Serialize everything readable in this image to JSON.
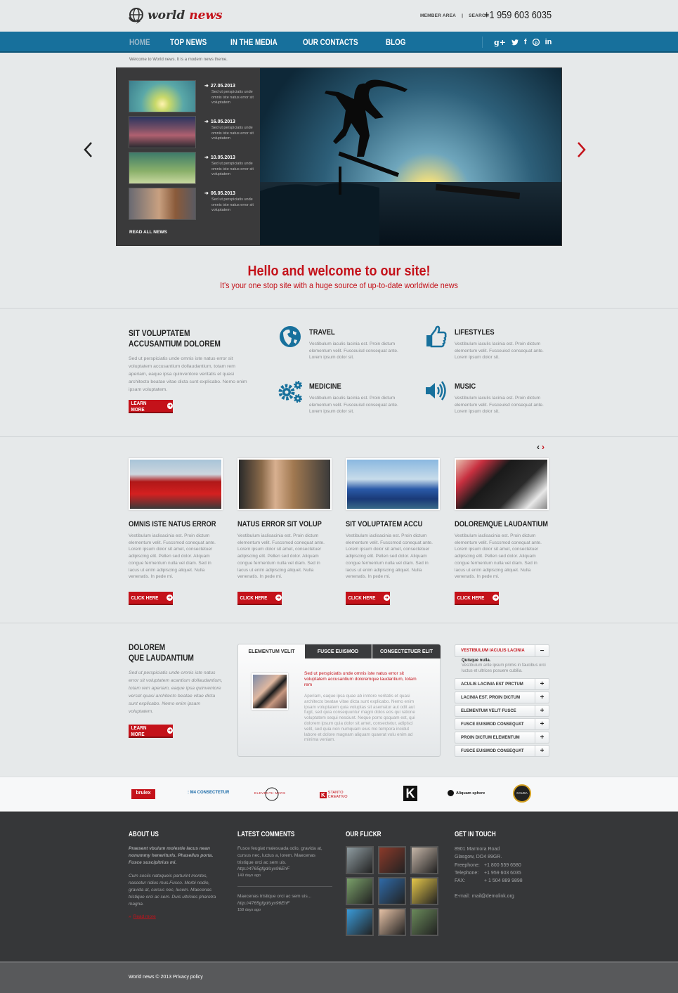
{
  "header": {
    "logo_word1": "world",
    "logo_word2": "news",
    "member_area": "MEMBER AREA",
    "separator": "|",
    "search": "SEARCH",
    "phone": "+1 959 603 6035"
  },
  "nav": {
    "items": [
      {
        "label": "HOME",
        "active": true
      },
      {
        "label": "TOP NEWS"
      },
      {
        "label": "IN THE MEDIA"
      },
      {
        "label": "OUR CONTACTS"
      },
      {
        "label": "BLOG"
      }
    ],
    "social": [
      {
        "icon": "google-plus-icon",
        "glyph": "g+"
      },
      {
        "icon": "twitter-icon",
        "glyph": "t"
      },
      {
        "icon": "facebook-icon",
        "glyph": "f"
      },
      {
        "icon": "pinterest-icon",
        "glyph": "p"
      },
      {
        "icon": "linkedin-icon",
        "glyph": "in"
      }
    ]
  },
  "welcome_text": "Welcome to World news. It is a modern news theme.",
  "slider": {
    "news": [
      {
        "date": "27.05.2013",
        "text": "Sed ut perspiciatis unde omnis iste natus error sit voluptatem"
      },
      {
        "date": "16.05.2013",
        "text": "Sed ut perspiciatis unde omnis iste natus error sit voluptatem"
      },
      {
        "date": "10.05.2013",
        "text": "Sed ut perspiciatis unde omnis iste natus error sit voluptatem"
      },
      {
        "date": "06.05.2013",
        "text": "Sed ut perspiciatis unde omnis iste natus error sit voluptatem"
      }
    ],
    "read_all": "READ ALL NEWS",
    "prev_glyph": "‹",
    "next_glyph": "›"
  },
  "hello": {
    "title": "Hello and welcome to our site!",
    "subtitle": "It's your one stop site with a huge source of up-to-date worldwide news"
  },
  "intro": {
    "title_line1": "SIT VOLUPTATEM",
    "title_line2": "ACCUSANTIUM DOLOREM",
    "text": "Sed ut perspiciatis unde omnis iste natus error sit voluptatem accusantium dollaudantium, totam rem aperiam, eaque ipsa quinventore veritatis et quasi architecto beatae vitae dicta sunt explicabo. Nemo enim ipsam voluptatem.",
    "button": "LEARN MORE"
  },
  "features": [
    {
      "title": "TRAVEL",
      "icon": "globe-icon",
      "text": "Vestibulum iaculis lacinia est. Proin dictum elementum velit. Fusceuisd consequat ante. Lorem ipsum dolor sit."
    },
    {
      "title": "LIFESTYLES",
      "icon": "thumbs-up-icon",
      "text": "Vestibulum iaculis lacinia est. Proin dictum elementum velit. Fusceuisd consequat ante. Lorem ipsum dolor sit."
    },
    {
      "title": "MEDICINE",
      "icon": "gears-icon",
      "text": "Vestibulum iaculis lacinia est. Proin dictum elementum velit. Fusceuisd consequat ante. Lorem ipsum dolor sit."
    },
    {
      "title": "MUSIC",
      "icon": "speaker-icon",
      "text": "Vestibulum iaculis lacinia est. Proin dictum elementum velit. Fusceuisd consequat ante. Lorem ipsum dolor sit."
    }
  ],
  "cards": {
    "prev_glyph": "‹",
    "next_glyph": "›",
    "items": [
      {
        "title": "OMNIS ISTE NATUS ERROR",
        "image": "red-car-image",
        "text": "Vestibulum iaclisacinia est. Proin dictum elementum velit. Fuscsmod conequat ante. Lorem ipsum dolor sit amet, consectetuer adipiscing elit. Pellen sed dolor. Aliquam congue fermentum  nulla vel diam. Sed in lacus ut enim adipiscing aliquet. Nulla venenatis. In pede mi.",
        "button": "CLICK HERE"
      },
      {
        "title": "NATUS ERROR SIT VOLUP",
        "image": "woman-portrait-image",
        "text": "Vestibulum iaclisacinia est. Proin dictum elementum velit. Fuscsmod conequat ante. Lorem ipsum dolor sit amet, consectetuer adipiscing elit. Pellen sed dolor. Aliquam congue fermentum  nulla vel diam. Sed in lacus ut enim adipiscing aliquet. Nulla venenatis. In pede mi.",
        "button": "CLICK HERE"
      },
      {
        "title": "SIT VOLUPTATEM ACCU",
        "image": "gondolas-image",
        "text": "Vestibulum iaclisacinia est. Proin dictum elementum velit. Fuscsmod conequat ante. Lorem ipsum dolor sit amet, consectetuer adipiscing elit. Pellen sed dolor. Aliquam congue fermentum  nulla vel diam. Sed in lacus ut enim adipiscing aliquet. Nulla venenatis. In pede mi.",
        "button": "CLICK HERE"
      },
      {
        "title": "DOLOREMQUE LAUDANTIUM",
        "image": "carnival-mask-image",
        "text": "Vestibulum iaclisacinia est. Proin dictum elementum velit. Fuscsmod conequat ante. Lorem ipsum dolor sit amet, consectetuer adipiscing elit. Pellen sed dolor. Aliquam congue fermentum  nulla vel diam. Sed in lacus ut enim adipiscing aliquet. Nulla venenatis. In pede mi.",
        "button": "CLICK HERE"
      }
    ]
  },
  "dolorem": {
    "title_line1": "DOLOREM",
    "title_line2": "QUE LAUDANTIUM",
    "text": "Sed ut perspiciatis unde omnis iste natus error sit voluptatem acantium dollaudantium, totam rem aperiam, eaque ipsa quinventore verset quasi architecto beatae vitae dicta sunt explicabo. Nemo enim ipsam voluptatem.",
    "button": "LEARN MORE"
  },
  "tabs": {
    "items": [
      {
        "label": "ELEMENTUM VELIT",
        "active": true
      },
      {
        "label": "FUSCE EUISMOD"
      },
      {
        "label": "CONSECTETUER ELIT"
      }
    ],
    "lead": "Sed ut perspiciatis unde omnis iste natus error sit voluptatem accusantium doloremque laudantium, totam rem",
    "body": "Aperiam, eaque ipsa quae ab inntore veritatis et quasi architecto beatae vitae dicta sunt explicabo. Nemo enim ipsam voluptatem quia voluptas sit asematur aut odit aut fugit, sed quia consequuntur magni dolos eos qui ratione voluptatem sequi nesciunt. Neque porro qsquam est, qui dolorem ipsum quia dolor sit amet, consectetur, adipisci velit, sed quia non numquam eius mo tempora incidut labore et dolore magnam aliquam quaerat volu enim ad minima veniam."
  },
  "accordion": {
    "open": {
      "label": "VESTIBULUM IACULIS LACINIA",
      "toggle": "−",
      "content_title": "Quisque nulla.",
      "content_text": "Vestibulum ante ipsum primis in faucibus orci luctus et ultrices posuere cubilia."
    },
    "items": [
      {
        "label": "ACULIS LACINIA EST PRCTUM",
        "toggle": "+"
      },
      {
        "label": "LACINIA EST. PROIN DICTUM",
        "toggle": "+"
      },
      {
        "label": "ELEMENTUM VELIT FUSCE",
        "toggle": "+"
      },
      {
        "label": "FUSCE EUISMOD CONSEQUAT",
        "toggle": "+"
      },
      {
        "label": "PROIN DICTUM ELEMENTUM",
        "toggle": "+"
      },
      {
        "label": "FUSCE EUISMOD CONSEQUAT",
        "toggle": "+"
      }
    ]
  },
  "partners": [
    {
      "name": "brulex"
    },
    {
      "name": ": M4 CONSECTETUR"
    },
    {
      "name": "ELEVENTH MARS"
    },
    {
      "name": "STANTO CREATIVO"
    },
    {
      "name": "K"
    },
    {
      "name": "Aliquam sphere"
    },
    {
      "name": "CAUSA"
    }
  ],
  "footer": {
    "about": {
      "title": "ABOUT US",
      "lead": "Praesent vbulum molestie lacus nean nonummy heneriturls. Phasellus porta. Fusce suscipitrius mi.",
      "text": "Cum sociis natoqueis parturint montes, nascetur ridius mus.Fusco. Morbi nodio, gravida at, cursus nec, lucem. Maecenas tristique orci ac sem. Duis ultricies pharetra magna.",
      "read_more": "Read more"
    },
    "comments": {
      "title": "LATEST COMMENTS",
      "items": [
        {
          "text": "Fusce feugiat malesuada odio, gravida at, cursus nec, luctus a, lorem. Maecenas tristique orci ac sem uis.",
          "link": "http://4765gfgd/syx96EhF",
          "age": "149 days ago"
        },
        {
          "text": "Maecenas tristique orci ac sem uis...",
          "link": "http://4765gfgd/syx96EhF",
          "age": "158 days ago"
        }
      ]
    },
    "flickr": {
      "title": "OUR FLICKR",
      "photos": [
        "#8f9ca1",
        "#8b3a2a",
        "#c6b6a8",
        "#7aa06a",
        "#2f6aa8",
        "#e6c84a",
        "#3a9ad8",
        "#e6c2a6",
        "#6a8a5a"
      ]
    },
    "contact": {
      "title": "GET IN TOUCH",
      "address1": "8901 Marmora Road",
      "address2": "Glasgow, DO4 89GR.",
      "freephone_label": "Freephone:",
      "freephone": "+1 800 559 6580",
      "telephone_label": "Telephone:",
      "telephone": "+1 959 603 6035",
      "fax_label": "FAX:",
      "fax": "+ 1 504 889 9898",
      "email_label": "E-mail:",
      "email": "mail@demolink.org"
    },
    "copyright": "World news © 2013 Privacy policy"
  },
  "colors": {
    "accent_red": "#c4121a",
    "nav_blue": "#17709c",
    "icon_blue": "#17709c",
    "footer_dark": "#363739"
  }
}
